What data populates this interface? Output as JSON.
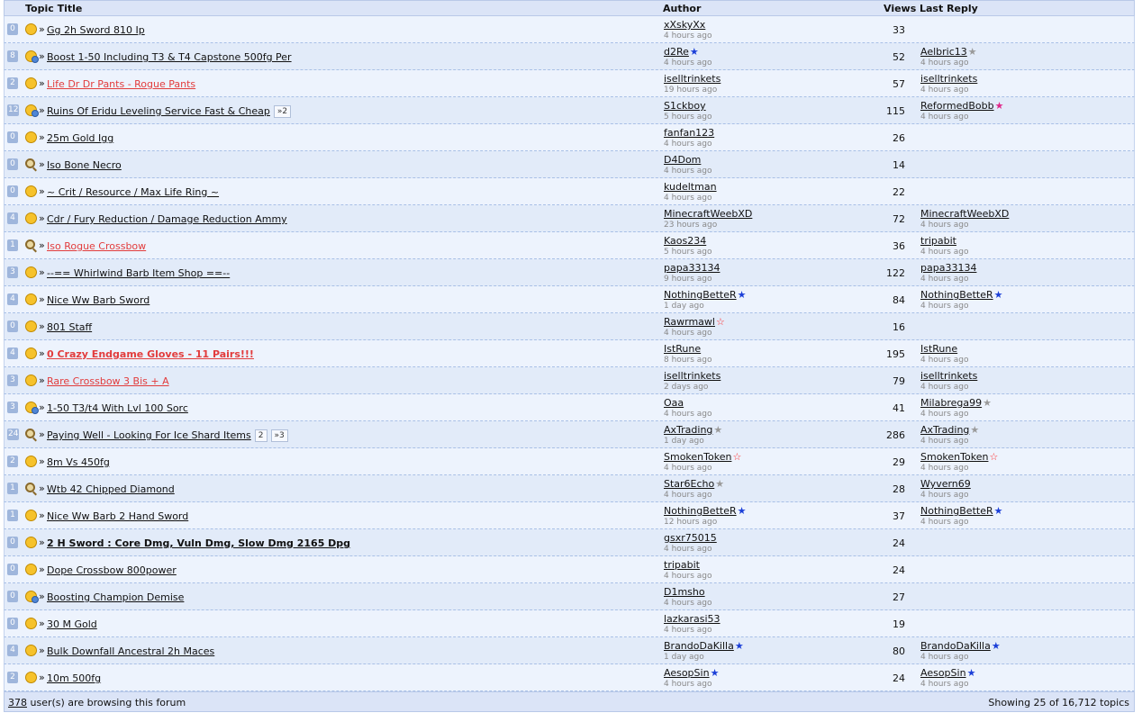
{
  "header": {
    "topic_title": "Topic Title",
    "author": "Author",
    "views": "Views",
    "last_reply": "Last Reply"
  },
  "colors": {
    "blue_star": "#1b3fd8",
    "gray_star": "#9a9a9a",
    "pink_star": "#e0288a",
    "red_outline_star": "#ff2a2a"
  },
  "topics": [
    {
      "replies": "0",
      "icon": "smiley-icon",
      "title": "Gg 2h Sword 810 Ip",
      "style": "normal",
      "pages": [],
      "author": "xXskyXx",
      "author_star": "",
      "posted": "4 hours ago",
      "views": "33",
      "last_user": "",
      "last_star": "",
      "last_time": ""
    },
    {
      "replies": "8",
      "icon": "chat-icon",
      "title": "Boost 1-50 Including T3 & T4 Capstone 500fg Per",
      "style": "normal",
      "pages": [],
      "author": "d2Re",
      "author_star": "blue",
      "posted": "4 hours ago",
      "views": "52",
      "last_user": "Aelbric13",
      "last_star": "gray",
      "last_time": "4 hours ago"
    },
    {
      "replies": "2",
      "icon": "smiley-icon",
      "title": "Life Dr Dr Pants - Rogue Pants",
      "style": "red",
      "pages": [],
      "author": "iselltrinkets",
      "author_star": "",
      "posted": "19 hours ago",
      "views": "57",
      "last_user": "iselltrinkets",
      "last_star": "",
      "last_time": "4 hours ago"
    },
    {
      "replies": "12",
      "icon": "chat-icon",
      "title": "Ruins Of Eridu Leveling Service Fast & Cheap",
      "style": "normal",
      "pages": [
        "»2"
      ],
      "author": "S1ckboy",
      "author_star": "",
      "posted": "5 hours ago",
      "views": "115",
      "last_user": "ReformedBobb",
      "last_star": "pink",
      "last_time": "4 hours ago"
    },
    {
      "replies": "0",
      "icon": "smiley-icon",
      "title": "25m Gold Igg",
      "style": "normal",
      "pages": [],
      "author": "fanfan123",
      "author_star": "",
      "posted": "4 hours ago",
      "views": "26",
      "last_user": "",
      "last_star": "",
      "last_time": ""
    },
    {
      "replies": "0",
      "icon": "magnifier-icon",
      "title": "Iso Bone Necro",
      "style": "normal",
      "pages": [],
      "author": "D4Dom",
      "author_star": "",
      "posted": "4 hours ago",
      "views": "14",
      "last_user": "",
      "last_star": "",
      "last_time": ""
    },
    {
      "replies": "0",
      "icon": "smiley-icon",
      "title": "~ Crit / Resource / Max Life Ring ~",
      "style": "normal",
      "pages": [],
      "author": "kudeltman",
      "author_star": "",
      "posted": "4 hours ago",
      "views": "22",
      "last_user": "",
      "last_star": "",
      "last_time": ""
    },
    {
      "replies": "4",
      "icon": "smiley-icon",
      "title": "Cdr / Fury Reduction / Damage Reduction Ammy",
      "style": "normal",
      "pages": [],
      "author": "MinecraftWeebXD",
      "author_star": "",
      "posted": "23 hours ago",
      "views": "72",
      "last_user": "MinecraftWeebXD",
      "last_star": "",
      "last_time": "4 hours ago"
    },
    {
      "replies": "1",
      "icon": "magnifier-icon",
      "title": "Iso Rogue Crossbow",
      "style": "red",
      "pages": [],
      "author": "Kaos234",
      "author_star": "",
      "posted": "5 hours ago",
      "views": "36",
      "last_user": "tripabit",
      "last_star": "",
      "last_time": "4 hours ago"
    },
    {
      "replies": "3",
      "icon": "smiley-icon",
      "title": "--== Whirlwind Barb Item Shop ==--",
      "style": "normal",
      "pages": [],
      "author": "papa33134",
      "author_star": "",
      "posted": "9 hours ago",
      "views": "122",
      "last_user": "papa33134",
      "last_star": "",
      "last_time": "4 hours ago"
    },
    {
      "replies": "4",
      "icon": "smiley-icon",
      "title": "Nice Ww Barb Sword",
      "style": "normal",
      "pages": [],
      "author": "NothingBetteR",
      "author_star": "blue",
      "posted": "1 day ago",
      "views": "84",
      "last_user": "NothingBetteR",
      "last_star": "blue",
      "last_time": "4 hours ago"
    },
    {
      "replies": "0",
      "icon": "smiley-icon",
      "title": "801 Staff",
      "style": "normal",
      "pages": [],
      "author": "Rawrmawl",
      "author_star": "red",
      "posted": "4 hours ago",
      "views": "16",
      "last_user": "",
      "last_star": "",
      "last_time": ""
    },
    {
      "replies": "4",
      "icon": "smiley-icon",
      "title": "0 Crazy Endgame Gloves - 11 Pairs!!!",
      "style": "red-bold",
      "pages": [],
      "author": "IstRune",
      "author_star": "",
      "posted": "8 hours ago",
      "views": "195",
      "last_user": "IstRune",
      "last_star": "",
      "last_time": "4 hours ago"
    },
    {
      "replies": "3",
      "icon": "smiley-icon",
      "title": "Rare Crossbow 3 Bis + A",
      "style": "red",
      "pages": [],
      "author": "iselltrinkets",
      "author_star": "",
      "posted": "2 days ago",
      "views": "79",
      "last_user": "iselltrinkets",
      "last_star": "",
      "last_time": "4 hours ago"
    },
    {
      "replies": "3",
      "icon": "chat-icon",
      "title": "1-50 T3/t4 With Lvl 100 Sorc",
      "style": "normal",
      "pages": [],
      "author": "Oaa",
      "author_star": "",
      "posted": "4 hours ago",
      "views": "41",
      "last_user": "Milabrega99",
      "last_star": "gray",
      "last_time": "4 hours ago"
    },
    {
      "replies": "24",
      "icon": "magnifier-icon",
      "title": "Paying Well - Looking For Ice Shard Items",
      "style": "normal",
      "pages": [
        "2",
        "»3"
      ],
      "author": "AxTrading",
      "author_star": "gray",
      "posted": "1 day ago",
      "views": "286",
      "last_user": "AxTrading",
      "last_star": "gray",
      "last_time": "4 hours ago"
    },
    {
      "replies": "2",
      "icon": "smiley-icon",
      "title": "8m Vs 450fg",
      "style": "normal",
      "pages": [],
      "author": "SmokenToken",
      "author_star": "red",
      "posted": "4 hours ago",
      "views": "29",
      "last_user": "SmokenToken",
      "last_star": "red",
      "last_time": "4 hours ago"
    },
    {
      "replies": "1",
      "icon": "magnifier-icon",
      "title": "Wtb 42 Chipped Diamond",
      "style": "normal",
      "pages": [],
      "author": "Star6Echo",
      "author_star": "gray",
      "posted": "4 hours ago",
      "views": "28",
      "last_user": "Wyvern69",
      "last_star": "",
      "last_time": "4 hours ago"
    },
    {
      "replies": "1",
      "icon": "smiley-icon",
      "title": "Nice Ww Barb 2 Hand Sword",
      "style": "normal",
      "pages": [],
      "author": "NothingBetteR",
      "author_star": "blue",
      "posted": "12 hours ago",
      "views": "37",
      "last_user": "NothingBetteR",
      "last_star": "blue",
      "last_time": "4 hours ago"
    },
    {
      "replies": "0",
      "icon": "smiley-icon",
      "title": "2 H Sword : Core Dmg, Vuln Dmg, Slow Dmg 2165 Dpg",
      "style": "bold",
      "pages": [],
      "author": "gsxr75015",
      "author_star": "",
      "posted": "4 hours ago",
      "views": "24",
      "last_user": "",
      "last_star": "",
      "last_time": ""
    },
    {
      "replies": "0",
      "icon": "smiley-icon",
      "title": "Dope Crossbow 800power",
      "style": "normal",
      "pages": [],
      "author": "tripabit",
      "author_star": "",
      "posted": "4 hours ago",
      "views": "24",
      "last_user": "",
      "last_star": "",
      "last_time": ""
    },
    {
      "replies": "0",
      "icon": "chat-icon",
      "title": "Boosting Champion Demise",
      "style": "normal",
      "pages": [],
      "author": "D1msho",
      "author_star": "",
      "posted": "4 hours ago",
      "views": "27",
      "last_user": "",
      "last_star": "",
      "last_time": ""
    },
    {
      "replies": "0",
      "icon": "smiley-icon",
      "title": "30 M Gold",
      "style": "normal",
      "pages": [],
      "author": "lazkarasi53",
      "author_star": "",
      "posted": "4 hours ago",
      "views": "19",
      "last_user": "",
      "last_star": "",
      "last_time": ""
    },
    {
      "replies": "4",
      "icon": "smiley-icon",
      "title": "Bulk Downfall Ancestral 2h Maces",
      "style": "normal",
      "pages": [],
      "author": "BrandoDaKilla",
      "author_star": "blue",
      "posted": "1 day ago",
      "views": "80",
      "last_user": "BrandoDaKilla",
      "last_star": "blue",
      "last_time": "4 hours ago"
    },
    {
      "replies": "2",
      "icon": "smiley-icon",
      "title": "10m 500fg",
      "style": "normal",
      "pages": [],
      "author": "AesopSin",
      "author_star": "blue",
      "posted": "4 hours ago",
      "views": "24",
      "last_user": "AesopSin",
      "last_star": "blue",
      "last_time": "4 hours ago"
    }
  ],
  "footer": {
    "browsing_count": "378",
    "browsing_text": " user(s) are browsing this forum",
    "showing": "Showing 25 of 16,712 topics"
  }
}
